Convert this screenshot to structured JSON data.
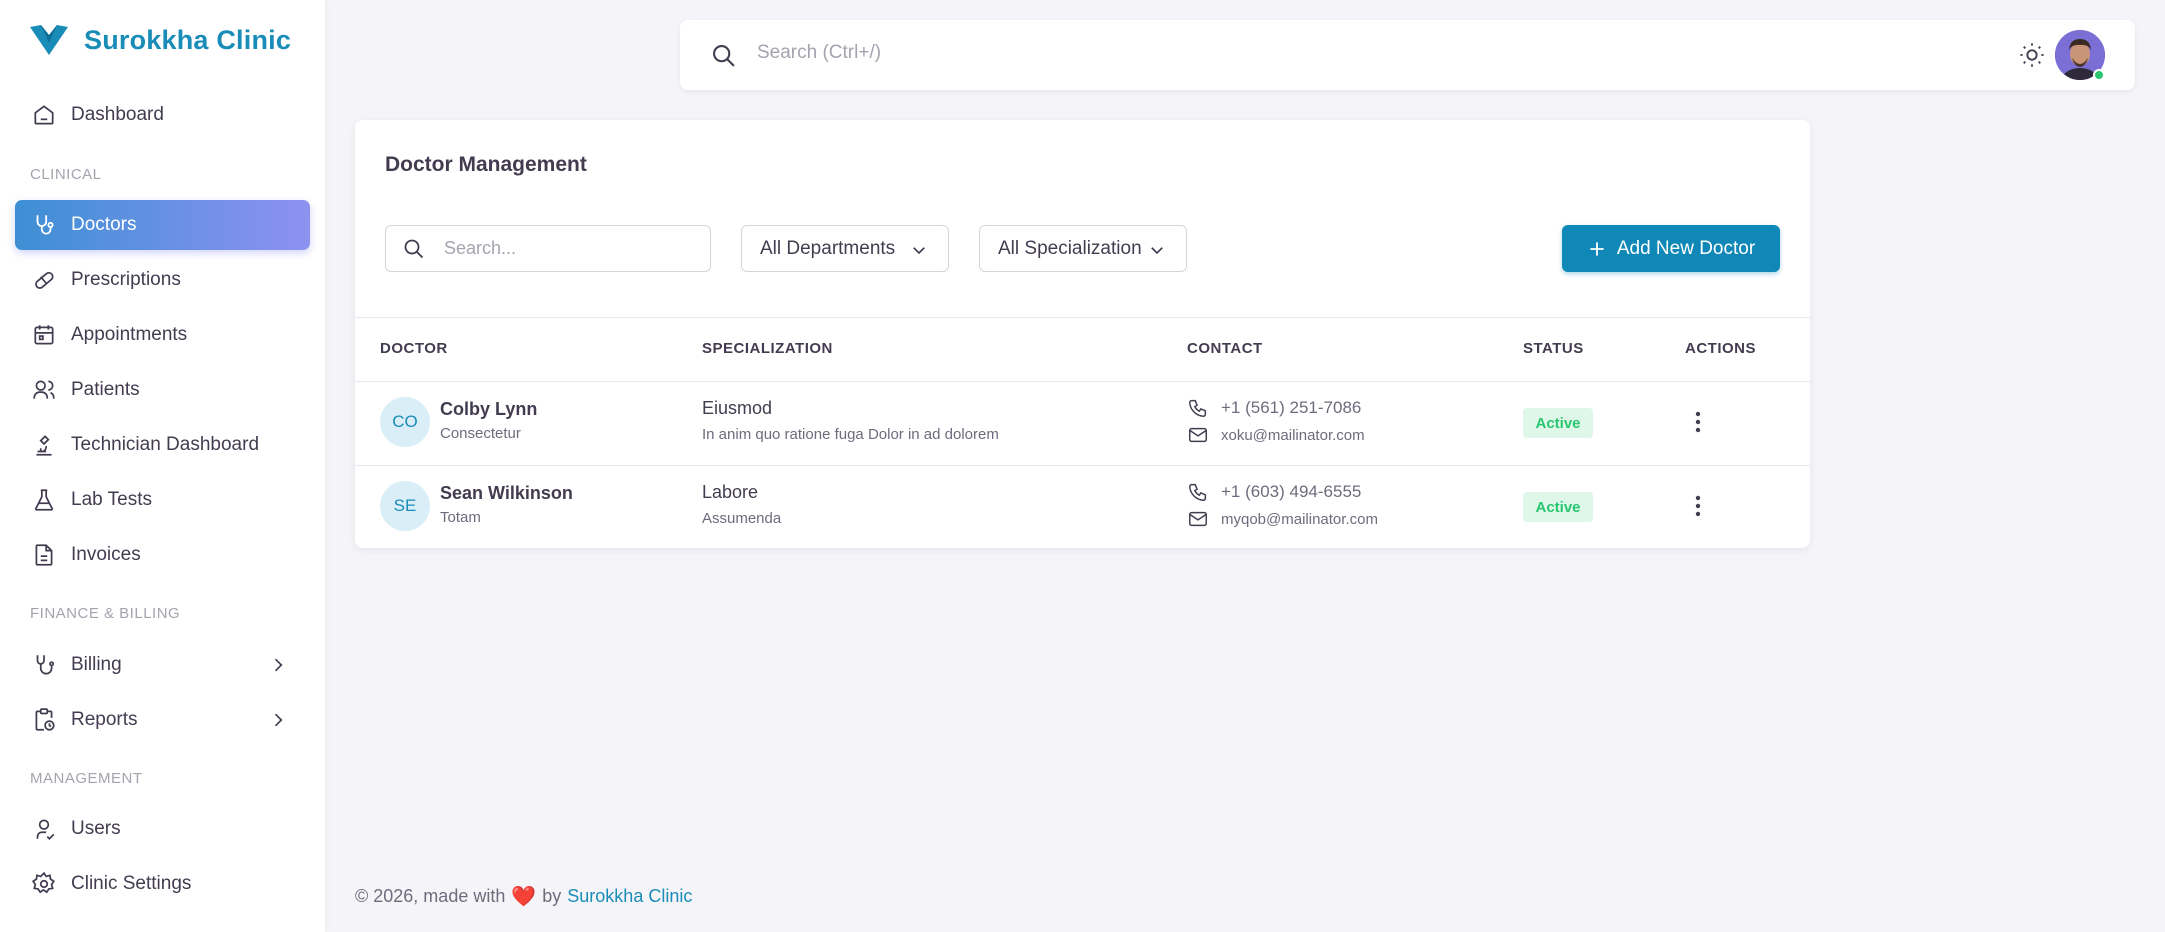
{
  "brand": {
    "name": "Surokkha Clinic",
    "color": "#1a8cb8"
  },
  "sidebar": {
    "items": [
      {
        "label": "Dashboard",
        "icon": "home-icon"
      },
      {
        "label": "Doctors",
        "icon": "stethoscope-icon",
        "active": true
      },
      {
        "label": "Prescriptions",
        "icon": "pill-icon"
      },
      {
        "label": "Appointments",
        "icon": "calendar-icon"
      },
      {
        "label": "Patients",
        "icon": "users-icon"
      },
      {
        "label": "Technician Dashboard",
        "icon": "microscope-icon"
      },
      {
        "label": "Lab Tests",
        "icon": "flask-icon"
      },
      {
        "label": "Invoices",
        "icon": "file-invoice-icon"
      },
      {
        "label": "Billing",
        "icon": "billing-icon"
      },
      {
        "label": "Reports",
        "icon": "report-icon"
      },
      {
        "label": "Users",
        "icon": "user-icon"
      },
      {
        "label": "Clinic Settings",
        "icon": "gear-icon"
      }
    ],
    "sections": {
      "clinical": "CLINICAL",
      "finance": "FINANCE & BILLING",
      "management": "MANAGEMENT"
    }
  },
  "topbar": {
    "search_placeholder": "Search (Ctrl+/)"
  },
  "page": {
    "title": "Doctor Management",
    "search_placeholder": "Search...",
    "department_filter": "All Departments",
    "specialization_filter": "All Specialization",
    "add_button": "Add New Doctor"
  },
  "table": {
    "headers": [
      "DOCTOR",
      "SPECIALIZATION",
      "CONTACT",
      "STATUS",
      "ACTIONS"
    ],
    "rows": [
      {
        "initials": "CO",
        "name": "Colby Lynn",
        "subtitle": "Consectetur",
        "specialization": "Eiusmod",
        "spec_desc": "In anim quo ratione fuga Dolor in ad dolorem",
        "phone": "+1 (561) 251-7086",
        "email": "xoku@mailinator.com",
        "status": "Active"
      },
      {
        "initials": "SE",
        "name": "Sean Wilkinson",
        "subtitle": "Totam",
        "specialization": "Labore",
        "spec_desc": "Assumenda",
        "phone": "+1 (603) 494-6555",
        "email": "myqob@mailinator.com",
        "status": "Active"
      }
    ]
  },
  "footer": {
    "prefix": "© 2026, made with",
    "heart": "❤️",
    "by": "by",
    "link": "Surokkha Clinic"
  },
  "colors": {
    "accent": "#0f87b7",
    "active_gradient_start": "#3d8fd4",
    "active_gradient_end": "#8e91f0",
    "status_active": "#28c76f"
  }
}
